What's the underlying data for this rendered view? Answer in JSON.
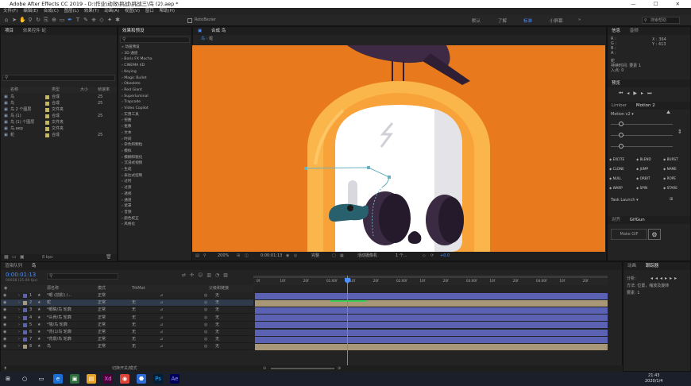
{
  "window": {
    "title": "Adobe After Effects CC 2019 - D:\\作业\\动效\\挑战\\挑战三\\鸟 (2).aep *",
    "controls": [
      "—",
      "☐",
      "✕"
    ]
  },
  "menu": [
    "文件(F)",
    "编辑(E)",
    "合成(C)",
    "图层(L)",
    "效果(T)",
    "动画(A)",
    "视图(V)",
    "窗口",
    "帮助(H)"
  ],
  "toolbar": {
    "rotobezier_label": "RotoBezier",
    "workspaces": [
      "默认",
      "了解",
      "标准",
      "小屏幕"
    ],
    "search_help_placeholder": "搜索帮助"
  },
  "project_panel": {
    "tabs": [
      "项目",
      "效果控件 蛇"
    ],
    "columns": [
      "名称",
      "类型",
      "大小",
      "帧速率"
    ],
    "items": [
      {
        "name": "鸟",
        "type": "合成",
        "fps": "25"
      },
      {
        "name": "鸟",
        "type": "合成",
        "fps": "25"
      },
      {
        "name": "鸟 2 个图层",
        "type": "文件夹",
        "fps": ""
      },
      {
        "name": "鸟 (1)",
        "type": "合成",
        "fps": "25"
      },
      {
        "name": "鸟 (1) 个图层",
        "type": "文件夹",
        "fps": ""
      },
      {
        "name": "鸟.aep",
        "type": "文件夹",
        "fps": ""
      },
      {
        "name": "蛇",
        "type": "合成",
        "fps": "25"
      }
    ],
    "bpc": "8 bpc"
  },
  "effects_panel": {
    "tab": "效果和预设",
    "items": [
      "» 动画预设",
      "› 3D 通道",
      "› Boris FX Mocha",
      "› CINEMA 4D",
      "› Keying",
      "› Magic Bullet",
      "› Obsolete",
      "› Red Giant",
      "› Superluminal",
      "› Trapcode",
      "› Video Copilot",
      "› 实用工具",
      "› 扭曲",
      "› 抠像",
      "› 文本",
      "› 时间",
      "› 杂色和颗粒",
      "› 模拟",
      "› 模糊和锐化",
      "› 沉浸式视频",
      "› 生成",
      "› 表达式控制",
      "› 过时",
      "› 过渡",
      "› 透视",
      "› 通道",
      "› 遮罩",
      "› 音频",
      "› 颜色校正",
      "› 风格化"
    ]
  },
  "composition": {
    "tab": "合成 鸟",
    "breadcrumb": [
      "鸟",
      "蛇"
    ],
    "zoom": "200%",
    "timecode": "0:00:01:13",
    "resolution": "完整",
    "camera": "活动摄像机",
    "views": "1 个...",
    "exposure": "+0.0",
    "colors": {
      "background": "#e87a1d",
      "arch_outer": "#fbb64b",
      "arch_inner": "#f8a23a",
      "skull": "#ffffff",
      "eyes": "#3a2a42",
      "bird": "#3e2a44",
      "snake": "#29606e"
    }
  },
  "info_panel": {
    "tabs": [
      "信息",
      "音频"
    ],
    "r": "R :",
    "g": "G :",
    "b": "B :",
    "a": "A :",
    "x": "X : 364",
    "y": "Y : 413",
    "layer_name": "蛇",
    "duration": "持续时间: 要素 1",
    "inpoint": "入点: 0"
  },
  "preview_panel": {
    "tab": "预览"
  },
  "motion_panel": {
    "tabs": [
      "Limber",
      "Motion 2"
    ],
    "preset": "Motion v2",
    "buttons": [
      "EXCITE",
      "BLEND",
      "BURST",
      "CLONE",
      "JUMP",
      "NAME",
      "NULL",
      "ORBIT",
      "ROPE",
      "WARP",
      "SPIN",
      "STARE"
    ],
    "task": "Task Launch",
    "task_btn": "⊞"
  },
  "gif_panel": {
    "tabs": [
      "对齐",
      "GifGun"
    ],
    "make_gif": "Make GIF"
  },
  "timeline": {
    "tabs": [
      "渲染队列",
      "鸟"
    ],
    "timecode": "0:00:01:13",
    "fps": "00038 (25.00 fps)",
    "columns": {
      "name": "源名称",
      "mode": "模式",
      "trkmat": "TrkMat",
      "parent": "父级和链接"
    },
    "layers": [
      {
        "num": "1",
        "name": "*眼 (前影) /...",
        "mode": "正常",
        "trkmat": "",
        "parent": "无",
        "color": "#5c62b3"
      },
      {
        "num": "2",
        "name": "蛇",
        "mode": "正常",
        "trkmat": "无",
        "parent": "无",
        "color": "#a89878"
      },
      {
        "num": "3",
        "name": "*眼睛/鸟 轮廓",
        "mode": "正常",
        "trkmat": "无",
        "parent": "无",
        "color": "#5c62b3"
      },
      {
        "num": "4",
        "name": "*头骨/鸟 轮廓",
        "mode": "正常",
        "trkmat": "无",
        "parent": "无",
        "color": "#5c62b3"
      },
      {
        "num": "5",
        "name": "*墙/鸟 轮廓",
        "mode": "正常",
        "trkmat": "无",
        "parent": "无",
        "color": "#5c62b3"
      },
      {
        "num": "6",
        "name": "*背(1/鸟 轮廓",
        "mode": "正常",
        "trkmat": "无",
        "parent": "无",
        "color": "#5c62b3"
      },
      {
        "num": "7",
        "name": "*背景/鸟 轮廓",
        "mode": "正常",
        "trkmat": "无",
        "parent": "无",
        "color": "#5c62b3"
      },
      {
        "num": "8",
        "name": "鸟",
        "mode": "正常",
        "trkmat": "无",
        "parent": "无",
        "color": "#a89878"
      }
    ],
    "ruler": [
      "0f",
      "10f",
      "20f",
      "01:00f",
      "10f",
      "20f",
      "02:00f",
      "10f",
      "20f",
      "03:00f",
      "10f",
      "20f",
      "04:00f",
      "10f",
      "20f"
    ],
    "footer": "切换开关/模式"
  },
  "paragraph_panel": {
    "tabs": [
      "动画",
      "跟踪器"
    ],
    "items": [
      "分析:",
      "方法: 位置，缩放及旋转",
      "要素: 1"
    ]
  },
  "taskbar": {
    "time": "21:43",
    "date": "2020/1/4",
    "apps": [
      "⊞",
      "○",
      "▭",
      "e",
      "▣",
      "▤",
      "Xd",
      "◉",
      "⬣",
      "Ps",
      "Ae"
    ]
  }
}
